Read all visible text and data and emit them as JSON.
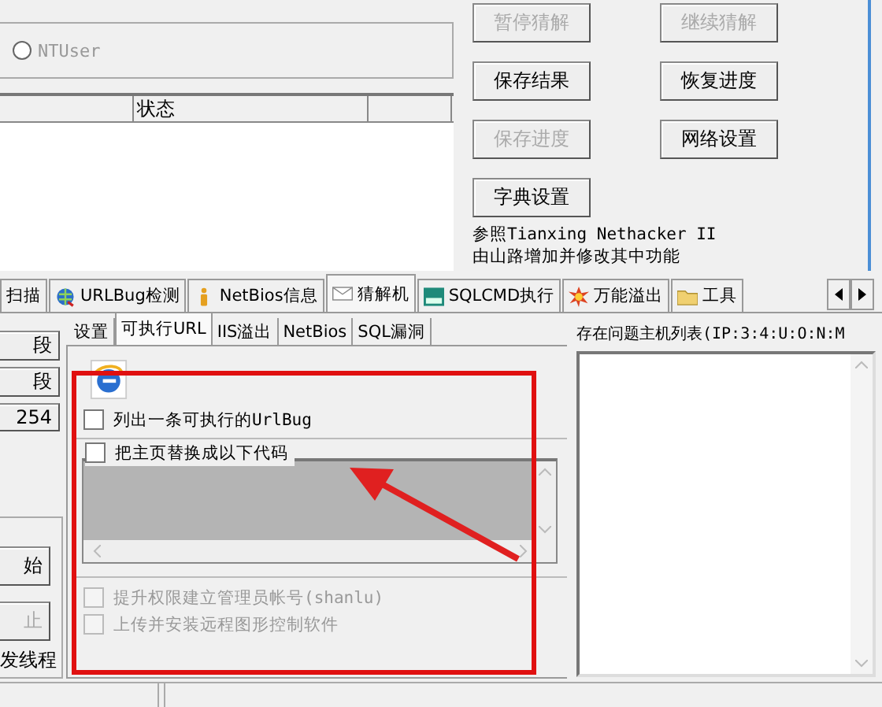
{
  "account_group": {
    "radio_label": "NTUser",
    "radio_selected": false
  },
  "result_list": {
    "column_2": "状态"
  },
  "buttons": [
    {
      "label": "暂停猜解",
      "disabled": true
    },
    {
      "label": "继续猜解",
      "disabled": true
    },
    {
      "label": "保存结果",
      "disabled": false
    },
    {
      "label": "恢复进度",
      "disabled": false
    },
    {
      "label": "保存进度",
      "disabled": true
    },
    {
      "label": "网络设置",
      "disabled": false
    },
    {
      "label": "字典设置",
      "disabled": false
    }
  ],
  "credits": [
    "参照Tianxing Nethacker II",
    "由山路增加并修改其中功能"
  ],
  "tabs": [
    {
      "label": "扫描",
      "selected": false
    },
    {
      "label": "URLBug检测",
      "selected": false
    },
    {
      "label": "NetBios信息",
      "selected": false
    },
    {
      "label": "猜解机",
      "selected": true
    },
    {
      "label": "SQLCMD执行",
      "selected": false
    },
    {
      "label": "万能溢出",
      "selected": false
    },
    {
      "label": "工具",
      "selected": false
    }
  ],
  "side_buttons": [
    {
      "label": "段"
    },
    {
      "label": "段"
    },
    {
      "label": "254"
    }
  ],
  "side_group": {
    "buttons": [
      {
        "label": "始",
        "disabled": false
      },
      {
        "label": "止",
        "disabled": true
      }
    ],
    "text": "发线程"
  },
  "inner_tabs": [
    {
      "label": "设置",
      "selected": false
    },
    {
      "label": "可执行URL",
      "selected": true
    },
    {
      "label": "IIS溢出",
      "selected": false
    },
    {
      "label": "NetBios",
      "selected": false
    },
    {
      "label": "SQL漏洞",
      "selected": false
    }
  ],
  "options": [
    {
      "label": "列出一条可执行的UrlBug",
      "checked": false,
      "disabled": false
    }
  ],
  "replace_group": {
    "checkbox": {
      "label": "把主页替换成以下代码",
      "checked": false,
      "disabled": false
    },
    "code_box": {
      "disabled": true
    }
  },
  "more_options": [
    {
      "label": "提升权限建立管理员帐号(shanlu)",
      "checked": false,
      "disabled": true
    },
    {
      "label": "上传并安装远程图形控制软件",
      "checked": false,
      "disabled": true
    }
  ],
  "host_list": {
    "label": "存在问题主机列表(IP:3:4:U:O:N:M"
  }
}
